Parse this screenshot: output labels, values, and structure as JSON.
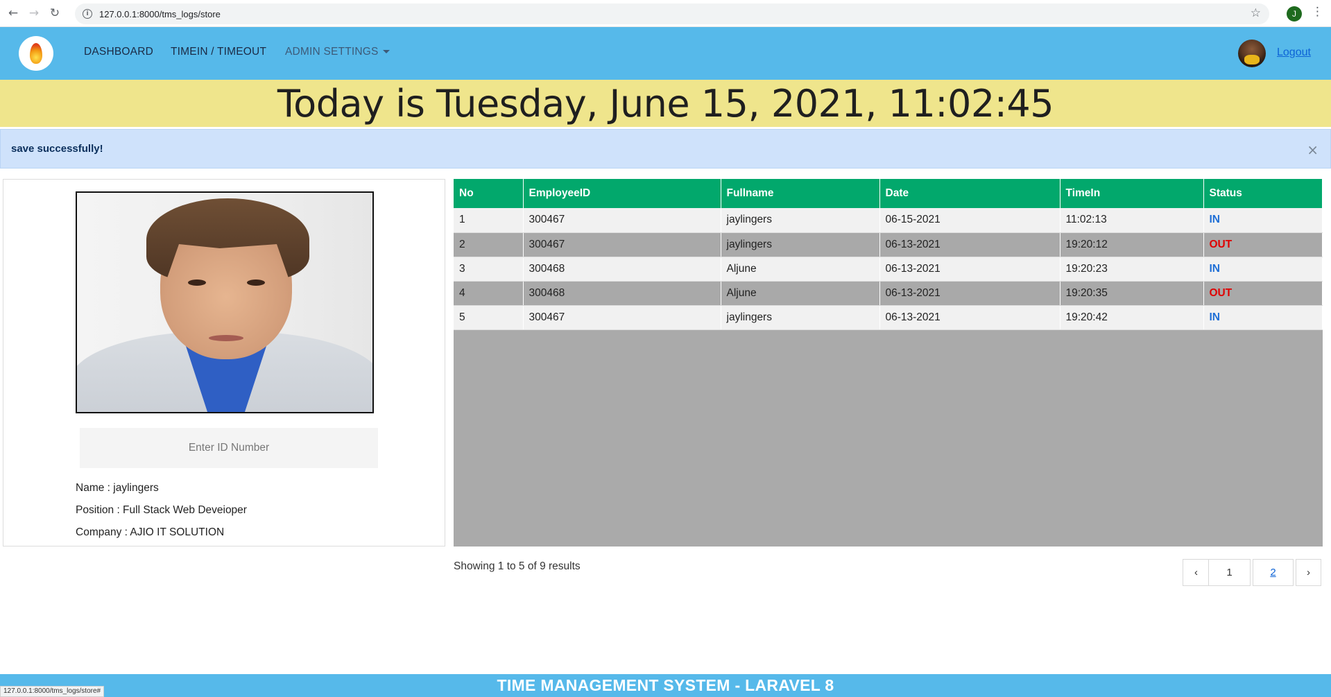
{
  "browser": {
    "url": "127.0.0.1:8000/tms_logs/store",
    "status_url": "127.0.0.1:8000/tms_logs/store#",
    "profile_initial": "J",
    "icons": [
      "back-arrow-icon",
      "forward-arrow-icon",
      "reload-icon",
      "info-icon",
      "star-icon",
      "menu-kebab-icon"
    ]
  },
  "navbar": {
    "links": [
      "DASHBOARD",
      "TIMEIN / TIMEOUT",
      "ADMIN SETTINGS"
    ],
    "logout": "Logout",
    "bg_color": "#56b9ea"
  },
  "banner": {
    "date_text": "Today is Tuesday, June 15, 2021, 11:02:45",
    "bg_color": "#efe58c"
  },
  "alert": {
    "message": "save successfully!",
    "close": "×"
  },
  "employee_card": {
    "id_placeholder": "Enter ID Number",
    "name_line": "Name : jaylingers",
    "position_line": "Position : Full Stack Web Deveioper",
    "company_line": "Company : AJIO IT SOLUTION"
  },
  "logs_table": {
    "header_color": "#02a86c",
    "columns": [
      "No",
      "EmployeeID",
      "Fullname",
      "Date",
      "TimeIn",
      "Status"
    ],
    "rows": [
      {
        "no": "1",
        "employee_id": "300467",
        "fullname": "jaylingers",
        "date": "06-15-2021",
        "time_in": "11:02:13",
        "status": "IN"
      },
      {
        "no": "2",
        "employee_id": "300467",
        "fullname": "jaylingers",
        "date": "06-13-2021",
        "time_in": "19:20:12",
        "status": "OUT"
      },
      {
        "no": "3",
        "employee_id": "300468",
        "fullname": "Aljune",
        "date": "06-13-2021",
        "time_in": "19:20:23",
        "status": "IN"
      },
      {
        "no": "4",
        "employee_id": "300468",
        "fullname": "Aljune",
        "date": "06-13-2021",
        "time_in": "19:20:35",
        "status": "OUT"
      },
      {
        "no": "5",
        "employee_id": "300467",
        "fullname": "jaylingers",
        "date": "06-13-2021",
        "time_in": "19:20:42",
        "status": "IN"
      }
    ]
  },
  "pagination": {
    "summary": "Showing 1 to 5 of 9 results",
    "prev": "‹",
    "pages": [
      "1",
      "2"
    ],
    "next": "›"
  },
  "footer": {
    "text": "TIME MANAGEMENT SYSTEM - LARAVEL 8"
  }
}
